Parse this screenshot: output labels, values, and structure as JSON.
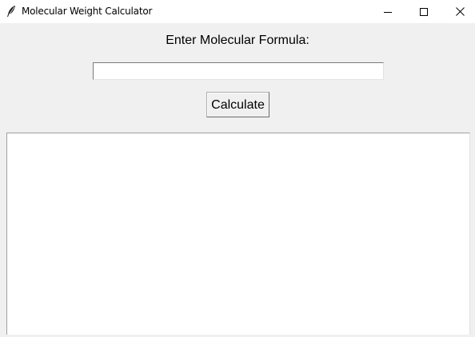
{
  "window": {
    "title": "Molecular Weight Calculator",
    "app_icon": "feather-icon",
    "controls": {
      "minimize_icon": "minimize-icon",
      "maximize_icon": "maximize-icon",
      "close_icon": "close-icon"
    }
  },
  "form": {
    "prompt_label": "Enter Molecular Formula:",
    "formula_value": "",
    "calculate_label": "Calculate"
  },
  "result": {
    "text": ""
  }
}
